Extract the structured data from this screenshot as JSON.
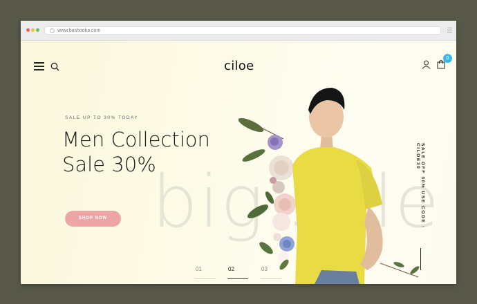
{
  "browser": {
    "url": "www.bashooka.com",
    "dots": [
      "#ec5f5b",
      "#f4c042",
      "#5dc655"
    ]
  },
  "header": {
    "logo": "ciloe",
    "cart_count": "0",
    "accent": "#39b8e6"
  },
  "hero": {
    "subtitle": "SALE UP TO 30% TODAY",
    "headline_line1": "Men Collection",
    "headline_line2": "Sale 30%",
    "button_label": "SHOP NOW",
    "button_color": "#eda6a8",
    "background_word": "big sale",
    "vertical_promo": "SALE OFF 30% USE CODE : CILOE30"
  },
  "pager": [
    {
      "label": "01",
      "active": false
    },
    {
      "label": "02",
      "active": true
    },
    {
      "label": "03",
      "active": false
    }
  ],
  "icons": [
    "hamburger-icon",
    "search-icon",
    "user-icon",
    "shopping-bag-icon"
  ]
}
